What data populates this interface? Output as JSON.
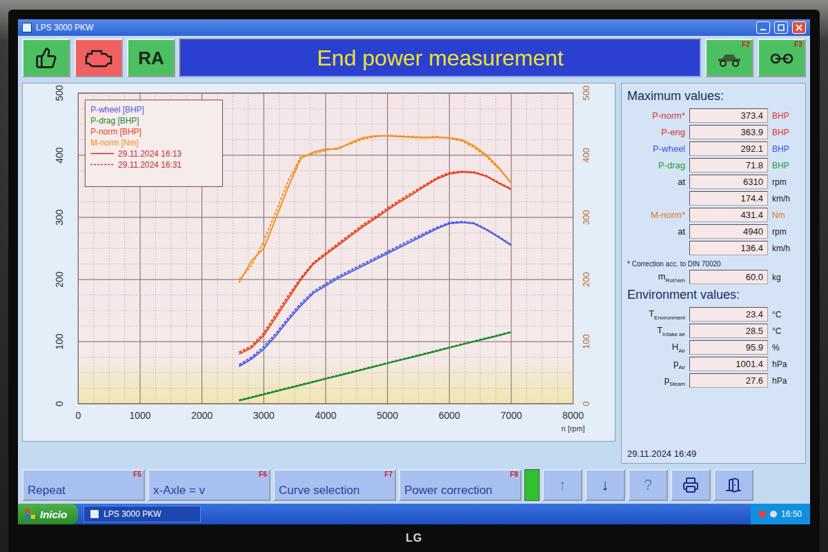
{
  "window": {
    "title": "LPS 3000 PKW"
  },
  "toolbar": {
    "ra_label": "RA",
    "heading": "End power measurement",
    "right_buttons": [
      {
        "key": "F2"
      },
      {
        "key": "F3"
      }
    ]
  },
  "chart": {
    "y_ticks": [
      "0",
      "100",
      "200",
      "300",
      "400",
      "500"
    ],
    "y_right_ticks": [
      "0",
      "100",
      "200",
      "300",
      "400",
      "500"
    ],
    "x_ticks": [
      "0",
      "1000",
      "2000",
      "3000",
      "4000",
      "5000",
      "6000",
      "7000",
      "8000"
    ],
    "x_label": "n [rpm]",
    "rpm": [
      2600,
      2800,
      3000,
      3200,
      3400,
      3600,
      3800,
      4000,
      4200,
      4400,
      4600,
      4800,
      5000,
      5200,
      5400,
      5600,
      5800,
      6000,
      6200,
      6400,
      6600,
      6800,
      7000
    ],
    "series": [
      {
        "name": "P-wheel [BHP]",
        "color": "#4a5ae0",
        "axis": "left",
        "runs": [
          [
            60,
            72,
            88,
            110,
            135,
            158,
            178,
            190,
            202,
            212,
            222,
            232,
            242,
            252,
            262,
            272,
            282,
            290,
            292,
            290,
            280,
            268,
            255
          ],
          [
            63,
            75,
            92,
            114,
            139,
            162,
            181,
            193,
            205,
            215,
            225,
            235,
            245,
            255,
            265,
            275,
            284,
            292,
            293,
            291,
            281,
            269,
            256
          ]
        ]
      },
      {
        "name": "P-drag [BHP]",
        "color": "#1a8a2a",
        "axis": "left",
        "runs": [
          [
            5,
            10,
            15,
            20,
            25,
            30,
            35,
            40,
            45,
            50,
            55,
            60,
            65,
            70,
            75,
            80,
            85,
            90,
            95,
            100,
            105,
            110,
            115
          ],
          [
            6,
            11,
            16,
            21,
            26,
            31,
            36,
            41,
            46,
            51,
            56,
            61,
            66,
            71,
            76,
            81,
            86,
            91,
            96,
            101,
            106,
            111,
            116
          ]
        ]
      },
      {
        "name": "P-norm [BHP]",
        "color": "#e8401a",
        "axis": "left",
        "runs": [
          [
            80,
            90,
            110,
            140,
            170,
            200,
            225,
            240,
            255,
            270,
            285,
            298,
            312,
            325,
            337,
            350,
            362,
            370,
            373,
            372,
            366,
            355,
            345
          ],
          [
            83,
            93,
            114,
            145,
            175,
            203,
            227,
            243,
            258,
            273,
            288,
            301,
            315,
            328,
            340,
            352,
            364,
            372,
            374,
            373,
            367,
            356,
            346
          ]
        ]
      },
      {
        "name": "M-norm [Nm]",
        "color": "#f0901a",
        "axis": "right",
        "runs": [
          [
            195,
            230,
            250,
            300,
            350,
            395,
            405,
            410,
            410,
            420,
            428,
            431,
            431,
            430,
            429,
            428,
            429,
            428,
            425,
            415,
            400,
            380,
            355
          ],
          [
            200,
            222,
            262,
            310,
            360,
            398,
            402,
            408,
            412,
            418,
            426,
            430,
            432,
            431,
            430,
            429,
            430,
            427,
            423,
            412,
            398,
            378,
            356
          ]
        ]
      }
    ],
    "runs": [
      {
        "label": "29.11.2024 16:13",
        "dashed": false
      },
      {
        "label": "29.11.2024 16:31",
        "dashed": true
      }
    ]
  },
  "maximum": {
    "title": "Maximum values:",
    "rows": [
      {
        "label": "P-norm*",
        "value": "373.4",
        "unit": "BHP",
        "color": "#e03030"
      },
      {
        "label": "P-eng",
        "value": "363.9",
        "unit": "BHP",
        "color": "#e03030"
      },
      {
        "label": "P-wheel",
        "value": "292.1",
        "unit": "BHP",
        "color": "#4050e0"
      },
      {
        "label": "P-drag",
        "value": "71.8",
        "unit": "BHP",
        "color": "#20a030"
      },
      {
        "label": "at",
        "value": "6310",
        "unit": "rpm",
        "color": "#222222"
      },
      {
        "label": "",
        "value": "174.4",
        "unit": "km/h",
        "color": "#222222"
      },
      {
        "label": "M-norm*",
        "value": "431.4",
        "unit": "Nm",
        "color": "#e07a10"
      },
      {
        "label": "at",
        "value": "4940",
        "unit": "rpm",
        "color": "#222222"
      },
      {
        "label": "",
        "value": "136.4",
        "unit": "km/h",
        "color": "#222222"
      }
    ]
  },
  "note": "* Correction acc. to DIN 70020",
  "mass": {
    "symbol": "m",
    "sub": "Rot/Veh",
    "value": "60.0",
    "unit": "kg"
  },
  "environment": {
    "title": "Environment values:",
    "rows": [
      {
        "symbol": "T",
        "sub": "Environment",
        "value": "23.4",
        "unit": "°C"
      },
      {
        "symbol": "T",
        "sub": "Intake air",
        "value": "28.5",
        "unit": "°C"
      },
      {
        "symbol": "H",
        "sub": "Air",
        "value": "95.9",
        "unit": "%"
      },
      {
        "symbol": "p",
        "sub": "Air",
        "value": "1001.4",
        "unit": "hPa"
      },
      {
        "symbol": "p",
        "sub": "Steam",
        "value": "27.6",
        "unit": "hPa"
      }
    ]
  },
  "timestamp": "29.11.2024  16:49",
  "function_keys": [
    {
      "label": "Repeat",
      "key": "F5"
    },
    {
      "label": "x-Axle = v",
      "key": "F6"
    },
    {
      "label": "Curve selection",
      "key": "F7"
    },
    {
      "label": "Power correction",
      "key": "F8"
    }
  ],
  "indicator": {
    "level": 1.0
  },
  "nav_buttons": [
    {
      "glyph": "↑",
      "disabled": true
    },
    {
      "glyph": "↓",
      "disabled": false
    },
    {
      "glyph": "?",
      "disabled": true
    }
  ],
  "taskbar": {
    "start": "Inicio",
    "task": "LPS 3000 PKW",
    "clock": "16:50"
  },
  "monitor": {
    "brand": "LG"
  }
}
